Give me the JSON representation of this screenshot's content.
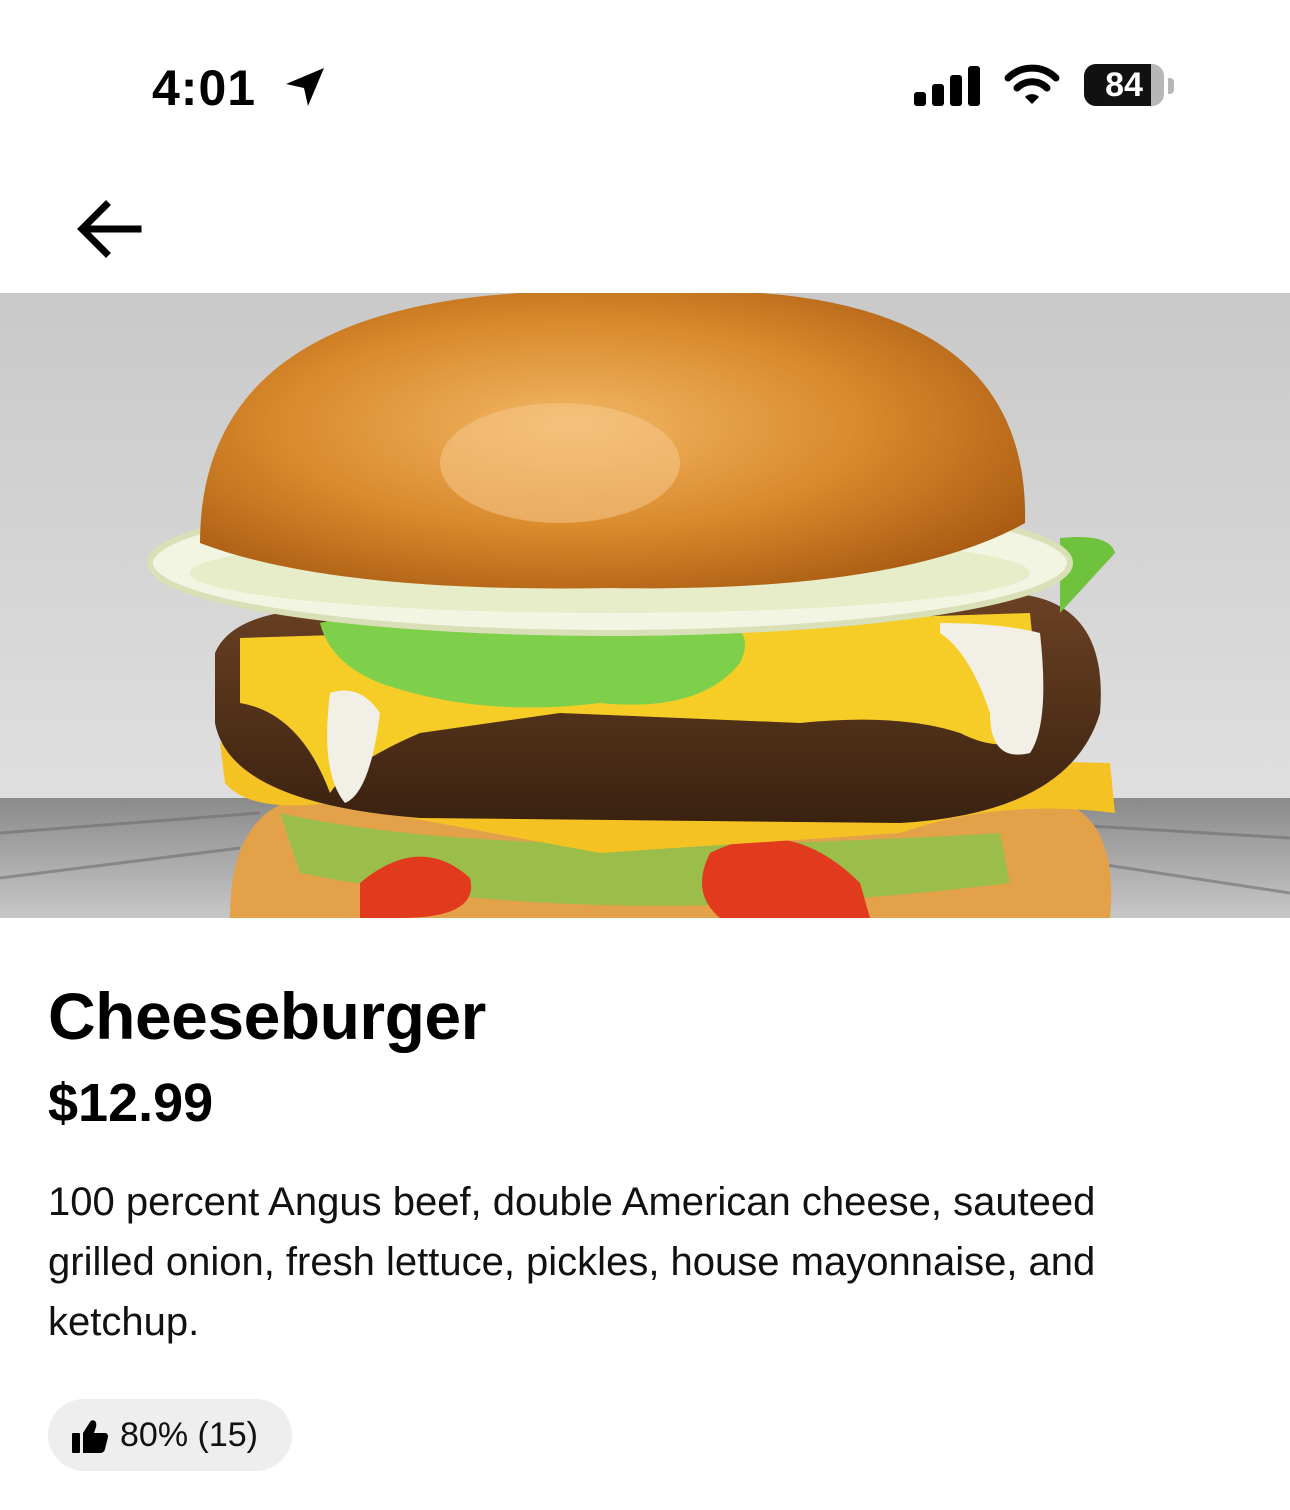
{
  "status_bar": {
    "time": "4:01",
    "battery_level": "84",
    "battery_fraction": 0.84,
    "icons": [
      "location-arrow-icon",
      "signal-bars-icon",
      "wifi-icon",
      "battery-icon"
    ]
  },
  "navigation": {
    "back_icon": "arrow-left-icon"
  },
  "item": {
    "name": "Cheeseburger",
    "price": "$12.99",
    "description": "100 percent Angus beef, double American cheese, sauteed grilled onion, fresh lettuce, pickles, house mayonnaise, and ketchup.",
    "rating": {
      "icon": "thumbs-up-icon",
      "text": "80% (15)"
    }
  }
}
